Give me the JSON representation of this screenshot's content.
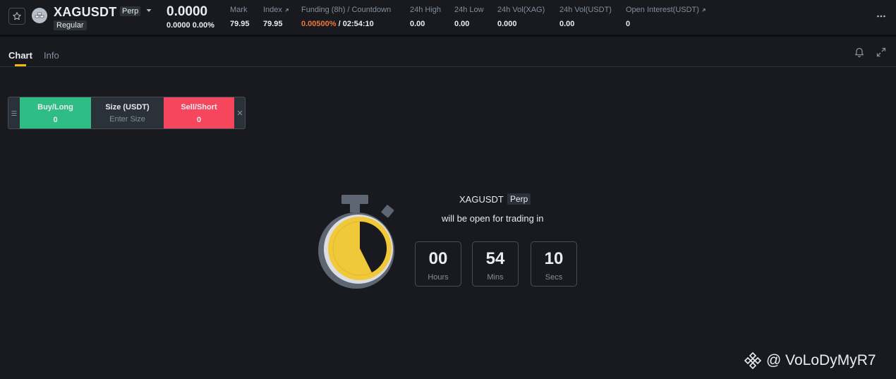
{
  "header": {
    "symbol": "XAGUSDT",
    "contract_type": "Perp",
    "tier": "Regular",
    "last_price": "0.0000",
    "price_change": "0.0000 0.00%",
    "mark_label": "Mark",
    "mark_value": "79.95",
    "index_label": "Index",
    "index_value": "79.95",
    "funding_label": "Funding (8h) / Countdown",
    "funding_rate": "0.00500%",
    "funding_countdown": " / 02:54:10",
    "high_label": "24h High",
    "high_value": "0.00",
    "low_label": "24h Low",
    "low_value": "0.00",
    "vol_base_label": "24h Vol(XAG)",
    "vol_base_value": "0.000",
    "vol_quote_label": "24h Vol(USDT)",
    "vol_quote_value": "0.00",
    "oi_label": "Open Interest(USDT)",
    "oi_value": "0"
  },
  "tabs": [
    {
      "label": "Chart",
      "active": true
    },
    {
      "label": "Info",
      "active": false
    }
  ],
  "quick_trade": {
    "buy_label": "Buy/Long",
    "buy_value": "0",
    "size_label": "Size (USDT)",
    "size_placeholder": "Enter Size",
    "sell_label": "Sell/Short",
    "sell_value": "0"
  },
  "countdown": {
    "symbol": "XAGUSDT",
    "badge": "Perp",
    "message": "will be open for trading in",
    "hours": "00",
    "hours_label": "Hours",
    "mins": "54",
    "mins_label": "Mins",
    "secs": "10",
    "secs_label": "Secs"
  },
  "watermark": {
    "text": "@ VoLoDyMyR7"
  },
  "colors": {
    "background": "#181a20",
    "buy": "#2ebd85",
    "sell": "#f6465d",
    "accent": "#f0b90b",
    "funding": "#f0773a",
    "muted_text": "#848e9c"
  },
  "icons": {
    "favorite": "star-icon",
    "coin": "silver-coin-icon",
    "dropdown": "caret-down-icon",
    "external": "arrow-up-right-icon",
    "more": "more-horizontal-icon",
    "alert": "bell-icon",
    "fullscreen": "expand-icon",
    "drag": "drag-handle-icon",
    "close": "close-icon",
    "timer": "stopwatch-icon",
    "brand": "binance-logo-icon"
  }
}
